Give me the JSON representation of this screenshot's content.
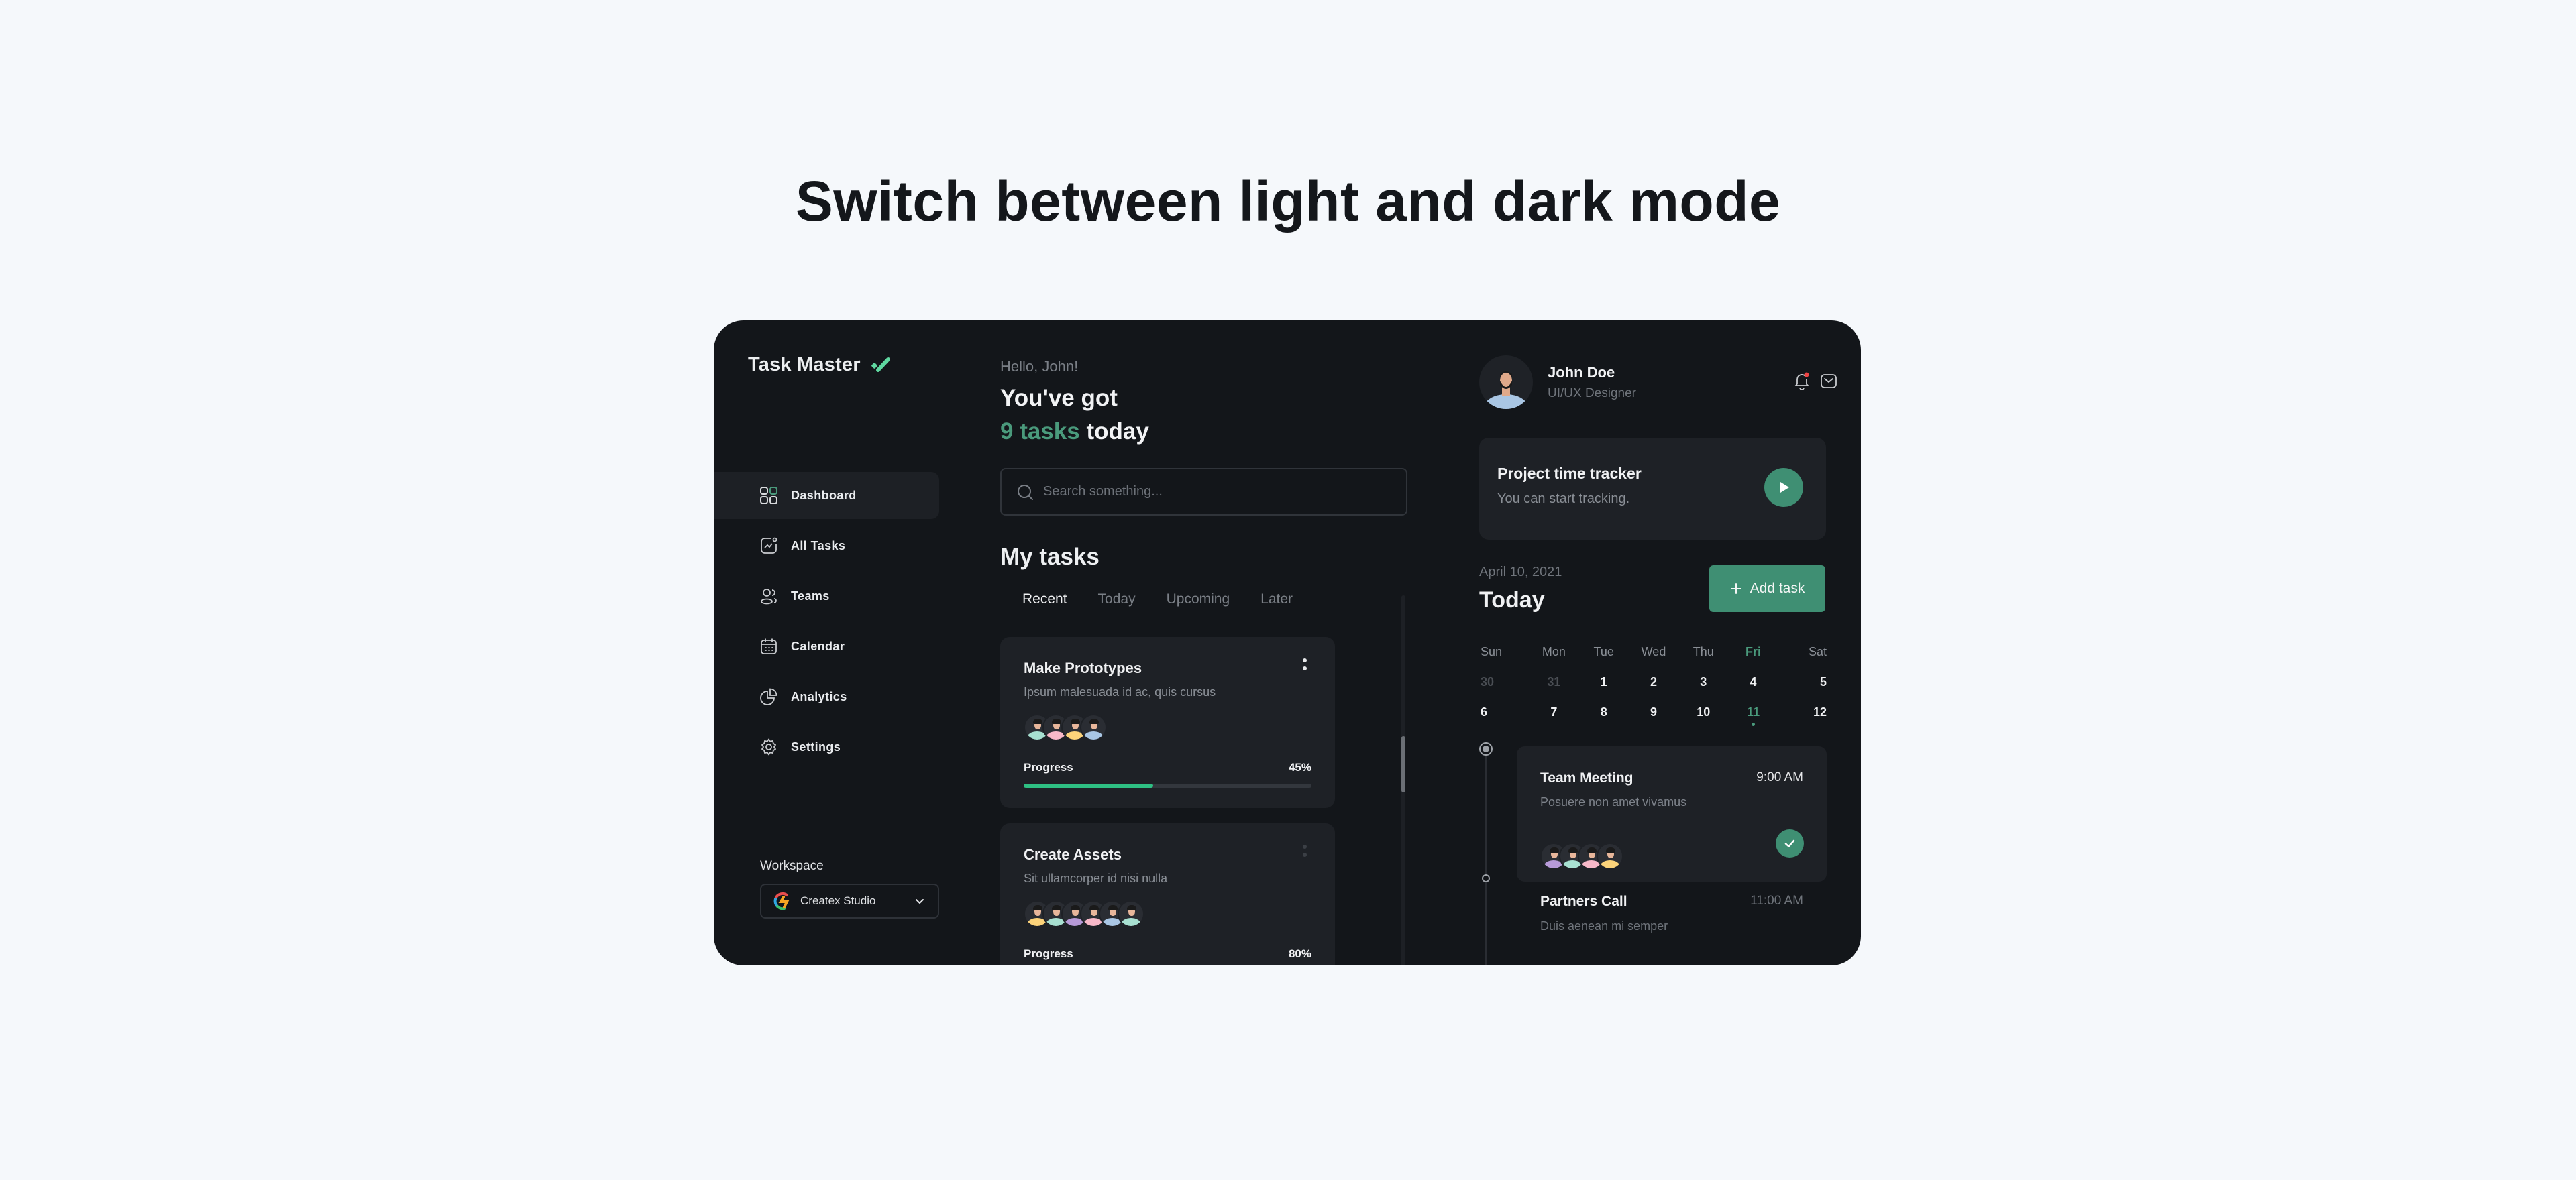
{
  "headline": "Switch between light and dark mode",
  "app": {
    "name": "Task Master",
    "accent_color": "#4a9a7c",
    "progress_color": "#2ec083",
    "button_color": "#3f8f73"
  },
  "sidebar": {
    "items": [
      {
        "label": "Dashboard",
        "icon": "dashboard-grid-icon",
        "active": true
      },
      {
        "label": "All Tasks",
        "icon": "tasks-chart-icon",
        "active": false
      },
      {
        "label": "Teams",
        "icon": "teams-icon",
        "active": false
      },
      {
        "label": "Calendar",
        "icon": "calendar-icon",
        "active": false
      },
      {
        "label": "Analytics",
        "icon": "pie-chart-icon",
        "active": false
      },
      {
        "label": "Settings",
        "icon": "gear-icon",
        "active": false
      }
    ],
    "workspace": {
      "label": "Workspace",
      "selected": "Createx Studio"
    }
  },
  "main": {
    "greeting": "Hello, John!",
    "headline_line1": "You've got",
    "headline_count": "9 tasks",
    "headline_suffix": "today",
    "search": {
      "placeholder": "Search something...",
      "value": ""
    },
    "section_title": "My tasks",
    "tabs": [
      {
        "label": "Recent",
        "active": true
      },
      {
        "label": "Today",
        "active": false
      },
      {
        "label": "Upcoming",
        "active": false
      },
      {
        "label": "Later",
        "active": false
      }
    ],
    "tasks": [
      {
        "title": "Make Prototypes",
        "description": "Ipsum malesuada id ac, quis cursus",
        "progress_label": "Progress",
        "progress_text": "45%",
        "progress": 0.45,
        "assignee_colors": [
          "#a8e0d1",
          "#f7b8c8",
          "#fcd37a",
          "#a9c6e4"
        ]
      },
      {
        "title": "Create Assets",
        "description": "Sit ullamcorper id nisi nulla",
        "progress_label": "Progress",
        "progress_text": "80%",
        "progress": 0.8,
        "assignee_colors": [
          "#fcd37a",
          "#a8e0d1",
          "#b79ad8",
          "#f7b8c8",
          "#a9c6e4",
          "#a8e0d1"
        ]
      }
    ]
  },
  "profile": {
    "name": "John Doe",
    "role": "UI/UX Designer",
    "has_notification": true
  },
  "tracker": {
    "title": "Project time tracker",
    "subtitle": "You can start tracking."
  },
  "schedule": {
    "date": "April 10, 2021",
    "title": "Today",
    "add_button": "Add task",
    "weekdays": [
      "Sun",
      "Mon",
      "Tue",
      "Wed",
      "Thu",
      "Fri",
      "Sat"
    ],
    "selected_weekday": "Fri",
    "weeks": [
      [
        {
          "d": "30",
          "muted": true
        },
        {
          "d": "31",
          "muted": true
        },
        {
          "d": "1"
        },
        {
          "d": "2"
        },
        {
          "d": "3"
        },
        {
          "d": "4"
        },
        {
          "d": "5"
        }
      ],
      [
        {
          "d": "6"
        },
        {
          "d": "7"
        },
        {
          "d": "8"
        },
        {
          "d": "9"
        },
        {
          "d": "10"
        },
        {
          "d": "11",
          "selected": true
        },
        {
          "d": "12"
        }
      ]
    ],
    "events": [
      {
        "title": "Team Meeting",
        "time": "9:00 AM",
        "description": "Posuere non amet vivamus",
        "completed": true,
        "attendee_colors": [
          "#b79ad8",
          "#a8e0d1",
          "#f7b8c8",
          "#fcd37a"
        ]
      },
      {
        "title": "Partners Call",
        "time": "11:00 AM",
        "description": "Duis aenean mi semper",
        "completed": false
      }
    ]
  }
}
